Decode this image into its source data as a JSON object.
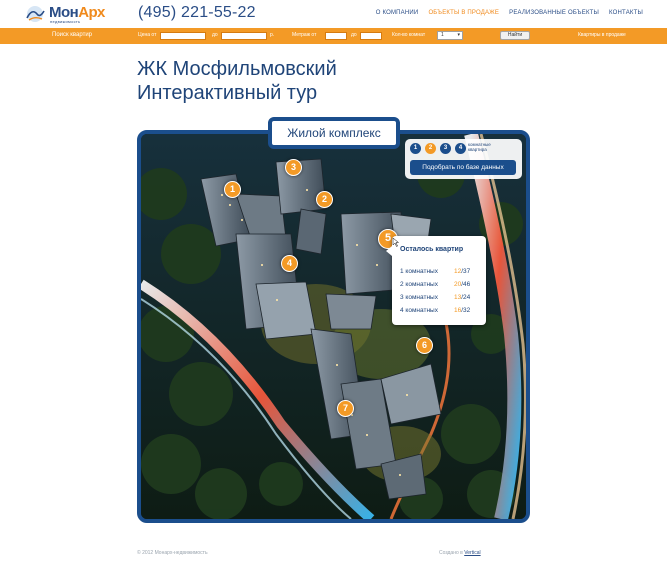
{
  "header": {
    "logo": {
      "part1": "Мон",
      "part2": "Арх",
      "sub": "недвижимость"
    },
    "phone": "(495) 221-55-22",
    "nav": [
      {
        "label": "О компании"
      },
      {
        "label": "Объекты в продаже"
      },
      {
        "label": "Реализованные объекты"
      },
      {
        "label": "Контакты"
      }
    ]
  },
  "searchbar": {
    "title": "Поиск квартир",
    "price_from": "Цена от",
    "price_to": "до",
    "price_unit": "р.",
    "area_from": "Метраж от",
    "area_to": "до",
    "rooms_label": "Кол-во комнат",
    "rooms_value": "1",
    "find_button": "Найти",
    "sale_link": "Квартиры в продаже"
  },
  "page": {
    "title_line1": "ЖК Мосфильмовский",
    "title_line2": "Интерактивный тур"
  },
  "tour": {
    "tab_label": "Жилой комплекс",
    "room_buttons": [
      "1",
      "2",
      "3",
      "4"
    ],
    "rooms_caption_1": "комнатные",
    "rooms_caption_2": "квартира",
    "db_button": "Подобрать по базе данных",
    "markers": [
      "1",
      "2",
      "3",
      "4",
      "5",
      "6",
      "7"
    ],
    "popup": {
      "title": "Осталось квартир",
      "rows": [
        {
          "label": "1 комнатных",
          "left": "12",
          "slash": "/",
          "total": "37"
        },
        {
          "label": "2 комнатных",
          "left": "20",
          "slash": "/",
          "total": "46"
        },
        {
          "label": "3 комнатных",
          "left": "13",
          "slash": "/",
          "total": "24"
        },
        {
          "label": "4 комнатных",
          "left": "16",
          "slash": "/",
          "total": "32"
        }
      ]
    }
  },
  "footer": {
    "copyright": "© 2012 Монарх-недвижимость",
    "made_prefix": "Создано в",
    "made_link": "Vertical"
  }
}
